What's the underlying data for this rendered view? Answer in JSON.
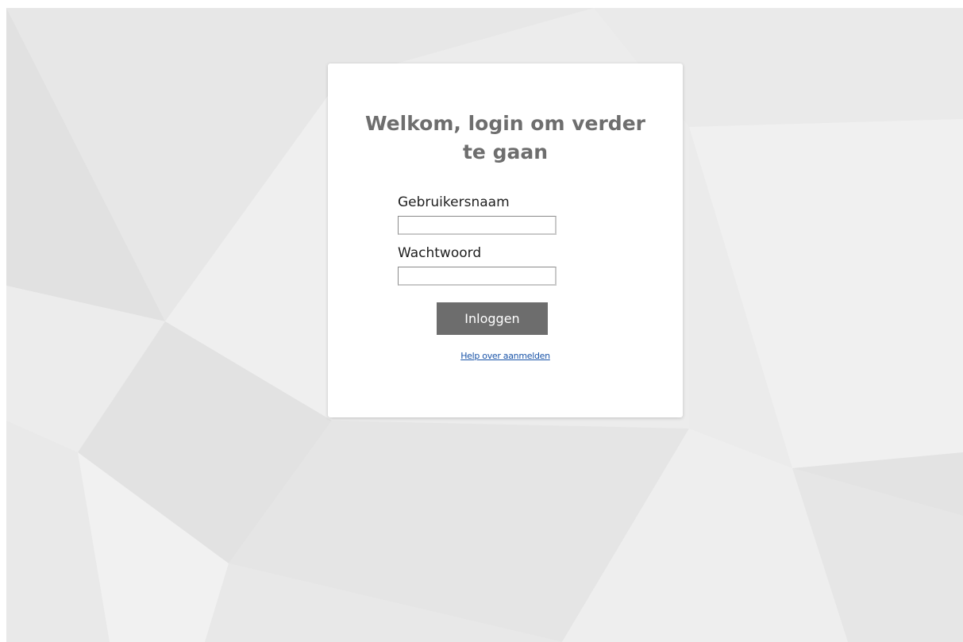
{
  "login": {
    "title": "Welkom, login om verder te gaan",
    "username_label": "Gebruikersnaam",
    "username_value": "",
    "password_label": "Wachtwoord",
    "password_value": "",
    "submit_label": "Inloggen",
    "help_link": "Help over aanmelden"
  },
  "colors": {
    "background": "#eeeeee",
    "card": "#ffffff",
    "title_text": "#6e6e6e",
    "button": "#6d6d6d",
    "link": "#1a54a8"
  }
}
